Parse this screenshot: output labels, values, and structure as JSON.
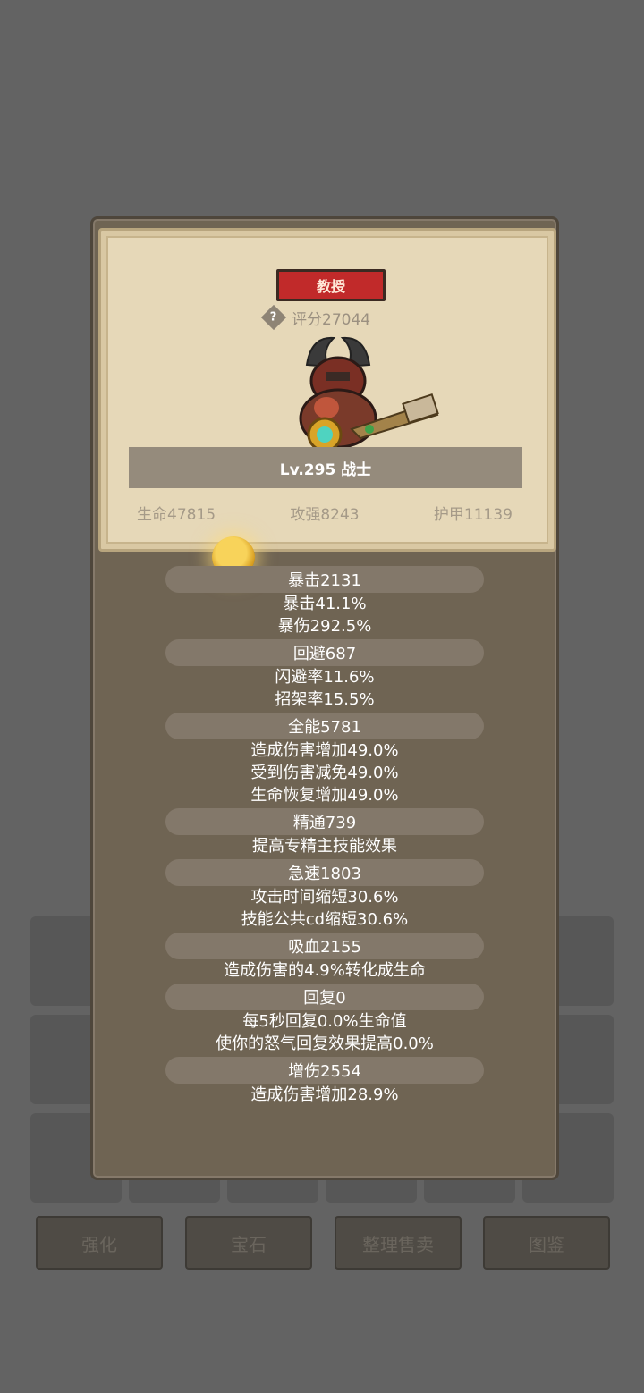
{
  "background": {
    "buttons": [
      "强化",
      "宝石",
      "整理售卖",
      "图鉴"
    ]
  },
  "hero": {
    "rank": "教授",
    "help_icon": "?",
    "score": "评分27044",
    "level_class": "Lv.295 战士",
    "base_stats": [
      "生命47815",
      "攻强8243",
      "护甲11139"
    ]
  },
  "stats": [
    {
      "header": "暴击2131",
      "details": [
        "暴击41.1%",
        "暴伤292.5%"
      ]
    },
    {
      "header": "回避687",
      "details": [
        "闪避率11.6%",
        "招架率15.5%"
      ]
    },
    {
      "header": "全能5781",
      "details": [
        "造成伤害增加49.0%",
        "受到伤害减免49.0%",
        "生命恢复增加49.0%"
      ]
    },
    {
      "header": "精通739",
      "details": [
        "提高专精主技能效果"
      ]
    },
    {
      "header": "急速1803",
      "details": [
        "攻击时间缩短30.6%",
        "技能公共cd缩短30.6%"
      ]
    },
    {
      "header": "吸血2155",
      "details": [
        "造成伤害的4.9%转化成生命"
      ]
    },
    {
      "header": "回复0",
      "details": [
        "每5秒回复0.0%生命值",
        "使你的怒气回复效果提高0.0%"
      ]
    },
    {
      "header": "增伤2554",
      "details": [
        "造成伤害增加28.9%"
      ]
    }
  ],
  "colors": {
    "page_bg": "#636363",
    "modal_bg": "#6f6453",
    "card_bg": "#e6d8b8",
    "rank_red": "#c12a2a",
    "header_pill": "#83786a"
  }
}
